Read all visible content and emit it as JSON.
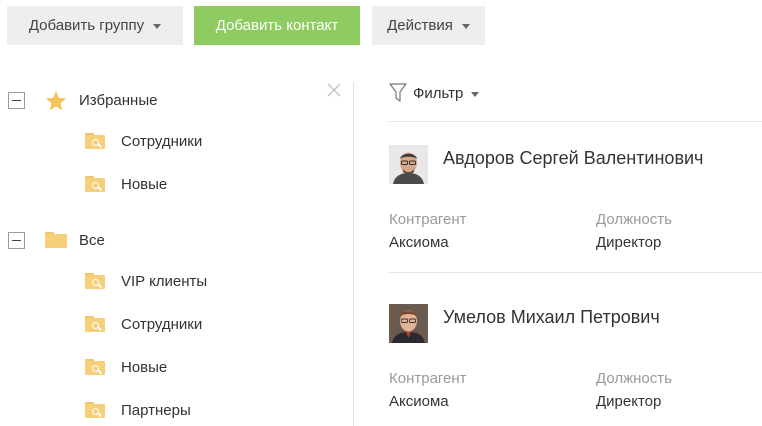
{
  "toolbar": {
    "add_group_label": "Добавить группу",
    "add_contact_label": "Добавить контакт",
    "actions_label": "Действия"
  },
  "tree": {
    "favorites": {
      "label": "Избранные",
      "children": [
        "Сотрудники",
        "Новые"
      ]
    },
    "all": {
      "label": "Все",
      "children": [
        "VIP клиенты",
        "Сотрудники",
        "Новые",
        "Партнеры"
      ]
    }
  },
  "filter": {
    "label": "Фильтр"
  },
  "contacts": [
    {
      "name": "Авдоров Сергей Валентинович",
      "account_label": "Контрагент",
      "account": "Аксиома",
      "position_label": "Должность",
      "position": "Директор"
    },
    {
      "name": "Умелов Михаил Петрович",
      "account_label": "Контрагент",
      "account": "Аксиома",
      "position_label": "Должность",
      "position": "Директор"
    }
  ],
  "colors": {
    "accent_green": "#8ecb60",
    "button_grey": "#eeeeee",
    "folder": "#f6cf7a",
    "star": "#f5c35a",
    "muted_text": "#9a9a9a"
  },
  "icons": [
    "chevron-down-icon",
    "star-icon",
    "folder-search-icon",
    "close-icon",
    "filter-icon",
    "minus-icon"
  ]
}
